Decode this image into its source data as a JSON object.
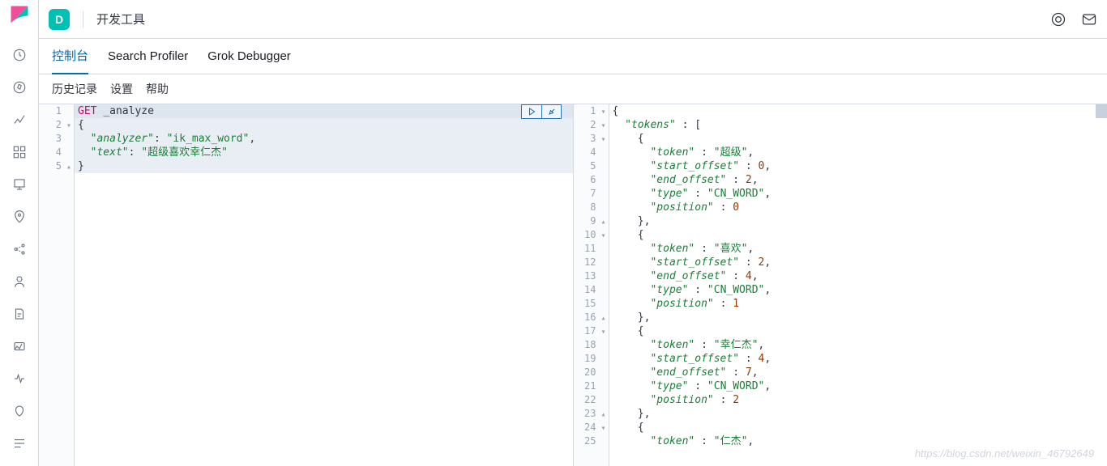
{
  "topbar": {
    "space_letter": "D",
    "title": "开发工具"
  },
  "tabs": [
    "控制台",
    "Search Profiler",
    "Grok Debugger"
  ],
  "active_tab": 0,
  "subbar": [
    "历史记录",
    "设置",
    "帮助"
  ],
  "request": {
    "method": "GET",
    "path": "_analyze",
    "lines": [
      {
        "n": 1,
        "fold": "",
        "segments": [
          [
            "method",
            "GET"
          ],
          [
            "punc",
            " "
          ],
          [
            "punc",
            "_analyze"
          ]
        ]
      },
      {
        "n": 2,
        "fold": "▾",
        "segments": [
          [
            "punc",
            "{"
          ]
        ]
      },
      {
        "n": 3,
        "fold": "",
        "segments": [
          [
            "punc",
            "  "
          ],
          [
            "key",
            "\"analyzer\""
          ],
          [
            "punc",
            ": "
          ],
          [
            "str",
            "\"ik_max_word\""
          ],
          [
            "punc",
            ","
          ]
        ]
      },
      {
        "n": 4,
        "fold": "",
        "segments": [
          [
            "punc",
            "  "
          ],
          [
            "key",
            "\"text\""
          ],
          [
            "punc",
            ": "
          ],
          [
            "str",
            "\"超级喜欢幸仁杰\""
          ]
        ]
      },
      {
        "n": 5,
        "fold": "▴",
        "segments": [
          [
            "punc",
            "}"
          ]
        ]
      }
    ]
  },
  "response": {
    "lines": [
      {
        "n": 1,
        "fold": "▾",
        "segments": [
          [
            "punc",
            "{"
          ]
        ]
      },
      {
        "n": 2,
        "fold": "▾",
        "segments": [
          [
            "punc",
            "  "
          ],
          [
            "key",
            "\"tokens\""
          ],
          [
            "punc",
            " : ["
          ]
        ]
      },
      {
        "n": 3,
        "fold": "▾",
        "segments": [
          [
            "punc",
            "    {"
          ]
        ]
      },
      {
        "n": 4,
        "fold": "",
        "segments": [
          [
            "punc",
            "      "
          ],
          [
            "key",
            "\"token\""
          ],
          [
            "punc",
            " : "
          ],
          [
            "str",
            "\"超级\""
          ],
          [
            "punc",
            ","
          ]
        ]
      },
      {
        "n": 5,
        "fold": "",
        "segments": [
          [
            "punc",
            "      "
          ],
          [
            "key",
            "\"start_offset\""
          ],
          [
            "punc",
            " : "
          ],
          [
            "num",
            "0"
          ],
          [
            "punc",
            ","
          ]
        ]
      },
      {
        "n": 6,
        "fold": "",
        "segments": [
          [
            "punc",
            "      "
          ],
          [
            "key",
            "\"end_offset\""
          ],
          [
            "punc",
            " : "
          ],
          [
            "num",
            "2"
          ],
          [
            "punc",
            ","
          ]
        ]
      },
      {
        "n": 7,
        "fold": "",
        "segments": [
          [
            "punc",
            "      "
          ],
          [
            "key",
            "\"type\""
          ],
          [
            "punc",
            " : "
          ],
          [
            "str",
            "\"CN_WORD\""
          ],
          [
            "punc",
            ","
          ]
        ]
      },
      {
        "n": 8,
        "fold": "",
        "segments": [
          [
            "punc",
            "      "
          ],
          [
            "key",
            "\"position\""
          ],
          [
            "punc",
            " : "
          ],
          [
            "num",
            "0"
          ]
        ]
      },
      {
        "n": 9,
        "fold": "▴",
        "segments": [
          [
            "punc",
            "    },"
          ]
        ]
      },
      {
        "n": 10,
        "fold": "▾",
        "segments": [
          [
            "punc",
            "    {"
          ]
        ]
      },
      {
        "n": 11,
        "fold": "",
        "segments": [
          [
            "punc",
            "      "
          ],
          [
            "key",
            "\"token\""
          ],
          [
            "punc",
            " : "
          ],
          [
            "str",
            "\"喜欢\""
          ],
          [
            "punc",
            ","
          ]
        ]
      },
      {
        "n": 12,
        "fold": "",
        "segments": [
          [
            "punc",
            "      "
          ],
          [
            "key",
            "\"start_offset\""
          ],
          [
            "punc",
            " : "
          ],
          [
            "num",
            "2"
          ],
          [
            "punc",
            ","
          ]
        ]
      },
      {
        "n": 13,
        "fold": "",
        "segments": [
          [
            "punc",
            "      "
          ],
          [
            "key",
            "\"end_offset\""
          ],
          [
            "punc",
            " : "
          ],
          [
            "num",
            "4"
          ],
          [
            "punc",
            ","
          ]
        ]
      },
      {
        "n": 14,
        "fold": "",
        "segments": [
          [
            "punc",
            "      "
          ],
          [
            "key",
            "\"type\""
          ],
          [
            "punc",
            " : "
          ],
          [
            "str",
            "\"CN_WORD\""
          ],
          [
            "punc",
            ","
          ]
        ]
      },
      {
        "n": 15,
        "fold": "",
        "segments": [
          [
            "punc",
            "      "
          ],
          [
            "key",
            "\"position\""
          ],
          [
            "punc",
            " : "
          ],
          [
            "num",
            "1"
          ]
        ]
      },
      {
        "n": 16,
        "fold": "▴",
        "segments": [
          [
            "punc",
            "    },"
          ]
        ]
      },
      {
        "n": 17,
        "fold": "▾",
        "segments": [
          [
            "punc",
            "    {"
          ]
        ]
      },
      {
        "n": 18,
        "fold": "",
        "segments": [
          [
            "punc",
            "      "
          ],
          [
            "key",
            "\"token\""
          ],
          [
            "punc",
            " : "
          ],
          [
            "str",
            "\"幸仁杰\""
          ],
          [
            "punc",
            ","
          ]
        ]
      },
      {
        "n": 19,
        "fold": "",
        "segments": [
          [
            "punc",
            "      "
          ],
          [
            "key",
            "\"start_offset\""
          ],
          [
            "punc",
            " : "
          ],
          [
            "num",
            "4"
          ],
          [
            "punc",
            ","
          ]
        ]
      },
      {
        "n": 20,
        "fold": "",
        "segments": [
          [
            "punc",
            "      "
          ],
          [
            "key",
            "\"end_offset\""
          ],
          [
            "punc",
            " : "
          ],
          [
            "num",
            "7"
          ],
          [
            "punc",
            ","
          ]
        ]
      },
      {
        "n": 21,
        "fold": "",
        "segments": [
          [
            "punc",
            "      "
          ],
          [
            "key",
            "\"type\""
          ],
          [
            "punc",
            " : "
          ],
          [
            "str",
            "\"CN_WORD\""
          ],
          [
            "punc",
            ","
          ]
        ]
      },
      {
        "n": 22,
        "fold": "",
        "segments": [
          [
            "punc",
            "      "
          ],
          [
            "key",
            "\"position\""
          ],
          [
            "punc",
            " : "
          ],
          [
            "num",
            "2"
          ]
        ]
      },
      {
        "n": 23,
        "fold": "▴",
        "segments": [
          [
            "punc",
            "    },"
          ]
        ]
      },
      {
        "n": 24,
        "fold": "▾",
        "segments": [
          [
            "punc",
            "    {"
          ]
        ]
      },
      {
        "n": 25,
        "fold": "",
        "segments": [
          [
            "punc",
            "      "
          ],
          [
            "key",
            "\"token\""
          ],
          [
            "punc",
            " : "
          ],
          [
            "str",
            "\"仁杰\""
          ],
          [
            "punc",
            ","
          ]
        ]
      }
    ]
  },
  "watermark": "https://blog.csdn.net/weixin_46792649"
}
